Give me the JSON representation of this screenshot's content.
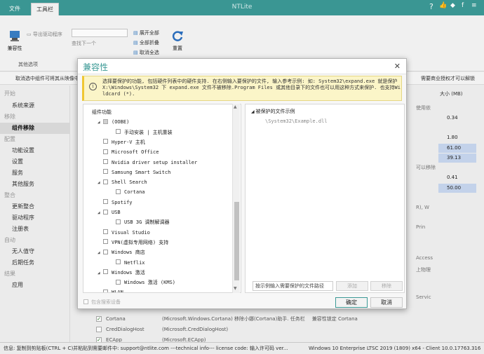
{
  "app": {
    "title": "NTLite"
  },
  "tabs": {
    "file": "文件",
    "toolbox": "工具栏"
  },
  "ribbon": {
    "compat_label": "兼容性",
    "export_drivers": "导出驱动程序",
    "find_next": "查找下一个",
    "expand_all": "展开全部",
    "collapse_all": "全部折叠",
    "uncheck_all": "取消全选",
    "reset": "重置",
    "group_other": "其他选项"
  },
  "info_strip": {
    "left": "取消选中组件可将其从映像中移除。",
    "right": "需要商业授权才可以解锁"
  },
  "sidebar": {
    "items": [
      {
        "label": "开始",
        "kind": "cat"
      },
      {
        "label": "系统来源",
        "kind": "sub"
      },
      {
        "label": "移除",
        "kind": "cat"
      },
      {
        "label": "组件移除",
        "kind": "sub",
        "active": true
      },
      {
        "label": "配置",
        "kind": "cat"
      },
      {
        "label": "功能设置",
        "kind": "sub"
      },
      {
        "label": "设置",
        "kind": "sub"
      },
      {
        "label": "服务",
        "kind": "sub"
      },
      {
        "label": "其他服务",
        "kind": "sub"
      },
      {
        "label": "整合",
        "kind": "cat"
      },
      {
        "label": "更新整合",
        "kind": "sub"
      },
      {
        "label": "驱动程序",
        "kind": "sub"
      },
      {
        "label": "注册表",
        "kind": "sub"
      },
      {
        "label": "自动",
        "kind": "cat"
      },
      {
        "label": "无人值守",
        "kind": "sub"
      },
      {
        "label": "后期任务",
        "kind": "sub"
      },
      {
        "label": "结果",
        "kind": "cat"
      },
      {
        "label": "应用",
        "kind": "sub"
      }
    ]
  },
  "bg": {
    "size_header": "大小 (MB)",
    "sizes": [
      "0.34",
      "1.80",
      "61.00",
      "39.13",
      "0.41",
      "50.00"
    ],
    "right_texts": [
      "使用依",
      "可以移除",
      "R), W",
      "Prin",
      "Access",
      "上物理",
      "Servic"
    ],
    "rows": [
      {
        "name": "Cortana",
        "desc": "(Microsoft.Windows.Cortana) 移除小娜(Cortana)助手. 任务栏",
        "extra": "兼容性锁定     Cortana",
        "checked": true
      },
      {
        "name": "CredDialogHost",
        "desc": "(Microsoft.CredDialogHost)",
        "checked": false
      },
      {
        "name": "ECApp",
        "desc": "(Microsoft.ECApp)",
        "checked": true
      }
    ]
  },
  "status": {
    "left": "信息: 复制到剪贴板(CTRL + C)并粘贴到需要邮件中: support@ntlite.com  ---technical info--- license code: 输入许可码 ver...",
    "right": "Windows 10 Enterprise LTSC 2019 (1809) x64 - Client 10.0.17763.316"
  },
  "dialog": {
    "title": "兼容性",
    "notice": "选择要保护的功能, 包括硬件列表中的硬件支持. 在右侧输入要保护的文件, 输入参考示例: 如: System32\\expand.exe 就是保护 X:\\Windows\\System32 下 expand.exe 文件不被移除.Program Files 或其他目录下的文件也可以用这种方式来保护. 也支持Wildcard (*).",
    "tree": [
      {
        "label": "组件功能",
        "level": 0,
        "arrow": "",
        "cb": false
      },
      {
        "label": "(OOBE)",
        "level": 1,
        "arrow": "◢",
        "cb": true,
        "partial": true
      },
      {
        "label": "手动安装 | 主机重装",
        "level": 2,
        "arrow": "",
        "cb": true
      },
      {
        "label": "Hyper-V 主机",
        "level": 1,
        "arrow": "",
        "cb": true
      },
      {
        "label": "Microsoft Office",
        "level": 1,
        "arrow": "",
        "cb": true
      },
      {
        "label": "Nvidia driver setup installer",
        "level": 1,
        "arrow": "",
        "cb": true
      },
      {
        "label": "Samsung Smart Switch",
        "level": 1,
        "arrow": "",
        "cb": true
      },
      {
        "label": "Shell Search",
        "level": 1,
        "arrow": "◢",
        "cb": true
      },
      {
        "label": "Cortana",
        "level": 2,
        "arrow": "",
        "cb": true
      },
      {
        "label": "Spotify",
        "level": 1,
        "arrow": "",
        "cb": true
      },
      {
        "label": "USB",
        "level": 1,
        "arrow": "◢",
        "cb": true
      },
      {
        "label": "USB 3G 调制解调器",
        "level": 2,
        "arrow": "",
        "cb": true
      },
      {
        "label": "Visual Studio",
        "level": 1,
        "arrow": "",
        "cb": true
      },
      {
        "label": "VPN(虚拟专用网络) 支持",
        "level": 1,
        "arrow": "",
        "cb": true
      },
      {
        "label": "Windows 商店",
        "level": 1,
        "arrow": "◢",
        "cb": true
      },
      {
        "label": "Netflix",
        "level": 2,
        "arrow": "",
        "cb": true
      },
      {
        "label": "Windows 激活",
        "level": 1,
        "arrow": "◢",
        "cb": true
      },
      {
        "label": "Windows 激活 (KMS)",
        "level": 2,
        "arrow": "",
        "cb": true
      },
      {
        "label": "WLAN",
        "level": 1,
        "arrow": "",
        "cb": true
      }
    ],
    "files_header": "被保护的文件示例",
    "file_example": "\\System32\\Example.dll",
    "path_placeholder": "按示例输入需要保护的文件路径",
    "add_label": "添加",
    "remove_label": "移除",
    "include_hosts": "包含搜索设备",
    "ok_label": "确定",
    "cancel_label": "取消"
  },
  "colors": {
    "accent": "#3c9a96",
    "notice_bg": "#fbf5c8",
    "highlight": "#c7d7ef"
  }
}
